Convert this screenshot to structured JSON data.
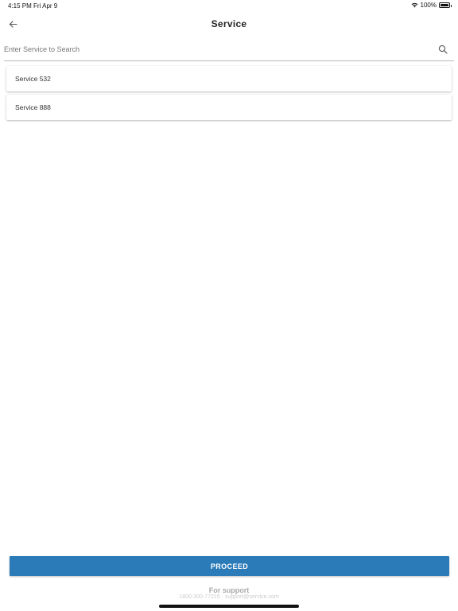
{
  "status_bar": {
    "time": "4:15 PM",
    "date": "Fri Apr 9",
    "battery_text": "100%",
    "battery_level": 1.0
  },
  "header": {
    "title": "Service",
    "back_icon": "arrow-left-icon"
  },
  "search": {
    "placeholder": "Enter Service to Search",
    "value": "",
    "icon": "search-icon"
  },
  "services": [
    {
      "label": "Service 532"
    },
    {
      "label": "Service 888"
    }
  ],
  "footer": {
    "proceed_label": "PROCEED",
    "support_title": "For support",
    "support_contact": "1800-300-77215 · support@service.com"
  },
  "colors": {
    "accent": "#2b7bb8",
    "background": "#ffffff"
  }
}
